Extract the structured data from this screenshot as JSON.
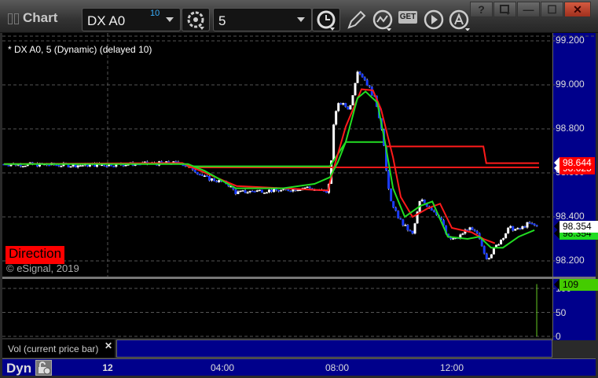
{
  "window": {
    "title": "Chart",
    "symbol": "DX A0",
    "symbol_superscript": "10",
    "interval": "5",
    "help": "?",
    "minimize": "—",
    "maximize": "☐",
    "close": "✕"
  },
  "toolbar": {
    "icons": [
      "settings-icon",
      "clock-icon",
      "pencil-icon",
      "study-icon",
      "get-icon",
      "play-icon",
      "alert-icon"
    ],
    "get_label": "GET"
  },
  "legend": "* DX A0, 5 (Dynamic) (delayed 10)",
  "direction_label": "Direction",
  "copyright": "© eSignal, 2019",
  "volume_label": "Vol (current price bar)",
  "volume_close": "✕",
  "time_mode": "Dyn",
  "colors": {
    "up": "#ffffff",
    "down": "#1a3cff",
    "ma_red": "#ff1a1a",
    "ma_green": "#22dd22",
    "axis": "#00008b"
  },
  "chart_data": {
    "type": "candlestick",
    "y_axis": {
      "ticks": [
        "99.200",
        "99.000",
        "98.800",
        "98.600",
        "98.400",
        "98.200"
      ],
      "values": [
        99.2,
        99.0,
        98.8,
        98.6,
        98.4,
        98.2
      ]
    },
    "x_axis": {
      "ticks": [
        {
          "label": "12",
          "hour": 0
        },
        {
          "label": "04:00",
          "hour": 4
        },
        {
          "label": "08:00",
          "hour": 8
        },
        {
          "label": "12:00",
          "hour": 12
        }
      ]
    },
    "price_anchors": [
      [
        -3.62,
        98.64
      ],
      [
        -1.01,
        98.635
      ],
      [
        2.55,
        98.645
      ],
      [
        2.96,
        98.62
      ],
      [
        3.37,
        98.58
      ],
      [
        4.19,
        98.55
      ],
      [
        4.47,
        98.51
      ],
      [
        5.29,
        98.52
      ],
      [
        6.11,
        98.52
      ],
      [
        6.93,
        98.535
      ],
      [
        7.62,
        98.51
      ],
      [
        7.75,
        98.56
      ],
      [
        7.89,
        98.85
      ],
      [
        8.08,
        98.92
      ],
      [
        8.44,
        98.89
      ],
      [
        8.71,
        99.07
      ],
      [
        8.99,
        99.02
      ],
      [
        9.34,
        98.93
      ],
      [
        9.59,
        98.78
      ],
      [
        9.75,
        98.55
      ],
      [
        9.95,
        98.44
      ],
      [
        10.27,
        98.37
      ],
      [
        10.63,
        98.32
      ],
      [
        10.9,
        98.48
      ],
      [
        11.26,
        98.44
      ],
      [
        11.59,
        98.4
      ],
      [
        11.86,
        98.3
      ],
      [
        12.19,
        98.3
      ],
      [
        12.55,
        98.35
      ],
      [
        12.88,
        98.32
      ],
      [
        13.23,
        98.21
      ],
      [
        13.56,
        98.27
      ],
      [
        14.0,
        98.35
      ],
      [
        14.33,
        98.34
      ],
      [
        14.66,
        98.37
      ],
      [
        15.04,
        98.354
      ]
    ],
    "ma_red": [
      [
        -3.62,
        98.64
      ],
      [
        2.6,
        98.645
      ],
      [
        3.4,
        98.6
      ],
      [
        4.5,
        98.54
      ],
      [
        7.7,
        98.52
      ],
      [
        7.75,
        98.56
      ],
      [
        8.3,
        98.81
      ],
      [
        8.85,
        98.98
      ],
      [
        9.25,
        98.975
      ],
      [
        9.53,
        98.89
      ],
      [
        9.95,
        98.67
      ],
      [
        10.22,
        98.49
      ],
      [
        10.63,
        98.4
      ],
      [
        11.18,
        98.44
      ],
      [
        11.59,
        98.46
      ],
      [
        12.0,
        98.35
      ],
      [
        12.69,
        98.33
      ],
      [
        13.1,
        98.3
      ],
      [
        13.5,
        98.28
      ]
    ],
    "ma_green": [
      [
        -3.62,
        98.64
      ],
      [
        2.8,
        98.64
      ],
      [
        3.37,
        98.61
      ],
      [
        4.47,
        98.53
      ],
      [
        6.11,
        98.53
      ],
      [
        7.21,
        98.55
      ],
      [
        7.75,
        98.58
      ],
      [
        8.03,
        98.65
      ],
      [
        8.3,
        98.74
      ],
      [
        8.71,
        98.94
      ],
      [
        8.99,
        98.97
      ],
      [
        9.4,
        98.92
      ],
      [
        9.67,
        98.74
      ],
      [
        9.95,
        98.53
      ],
      [
        10.36,
        98.4
      ],
      [
        10.9,
        98.45
      ],
      [
        11.32,
        98.47
      ],
      [
        11.86,
        98.31
      ],
      [
        12.55,
        98.3
      ],
      [
        12.96,
        98.31
      ],
      [
        13.37,
        98.26
      ],
      [
        13.78,
        98.26
      ],
      [
        14.33,
        98.31
      ],
      [
        14.88,
        98.34
      ]
    ],
    "levels_red": [
      [
        [
          2.8,
          98.625
        ],
        [
          15.04,
          98.625
        ]
      ],
      [
        [
          9.7,
          98.72
        ],
        [
          13.1,
          98.72
        ],
        [
          13.2,
          98.644
        ],
        [
          15.04,
          98.644
        ]
      ]
    ],
    "levels_green": [
      [
        [
          2.8,
          98.63
        ],
        [
          7.75,
          98.63
        ],
        [
          8.3,
          98.74
        ],
        [
          9.6,
          98.74
        ]
      ]
    ],
    "last_price": "98.354",
    "last_price_green": "98.354",
    "level_red": "98.644",
    "level_red2": "98.625",
    "volume": {
      "ticks": [
        "100",
        "50",
        "0"
      ],
      "tick_values": [
        100,
        50,
        0
      ],
      "last": "109",
      "bar": {
        "hour": 14.96,
        "value": 109
      }
    }
  }
}
